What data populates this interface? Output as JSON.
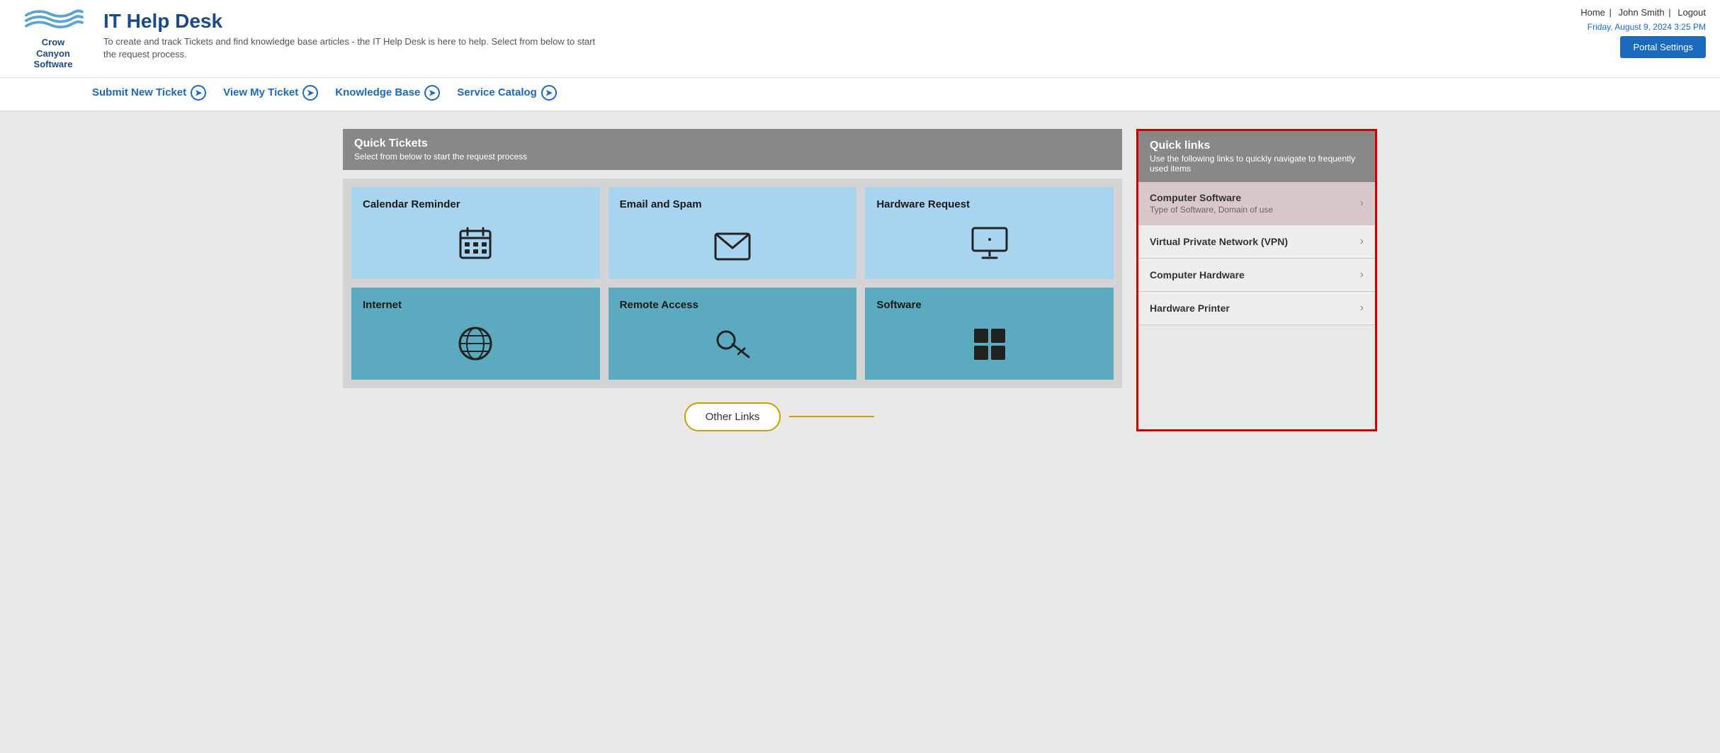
{
  "header": {
    "title": "IT Help Desk",
    "subtitle": "To create and track Tickets and find knowledge base articles - the IT Help Desk is here to help. Select from below to start the request process.",
    "logo_line1": "Crow",
    "logo_line2": "Canyon",
    "logo_line3": "Software",
    "nav_home": "Home",
    "nav_user": "John Smith",
    "nav_logout": "Logout",
    "date": "Friday, August 9, 2024 3:25 PM",
    "portal_settings": "Portal Settings"
  },
  "navbar": {
    "links": [
      {
        "label": "Submit New Ticket",
        "id": "submit-new-ticket"
      },
      {
        "label": "View My Ticket",
        "id": "view-my-ticket"
      },
      {
        "label": "Knowledge Base",
        "id": "knowledge-base"
      },
      {
        "label": "Service Catalog",
        "id": "service-catalog"
      }
    ]
  },
  "quick_tickets": {
    "title": "Quick Tickets",
    "subtitle": "Select from below to start the request process",
    "cards": [
      {
        "title": "Calendar Reminder",
        "icon": "📅",
        "teal": false
      },
      {
        "title": "Email and Spam",
        "icon": "✉️",
        "teal": false
      },
      {
        "title": "Hardware Request",
        "icon": "🖥️",
        "teal": false
      },
      {
        "title": "Internet",
        "icon": "🌐",
        "teal": true
      },
      {
        "title": "Remote Access",
        "icon": "🔑",
        "teal": true
      },
      {
        "title": "Software",
        "icon": "⊞",
        "teal": true
      }
    ]
  },
  "other_links": {
    "label": "Other Links"
  },
  "quick_links": {
    "title": "Quick links",
    "subtitle": "Use the following links to quickly navigate to frequently used items",
    "items": [
      {
        "title": "Computer Software",
        "subtitle": "Type of Software, Domain of use",
        "active": true
      },
      {
        "title": "Virtual Private Network (VPN)",
        "subtitle": "",
        "active": false
      },
      {
        "title": "Computer Hardware",
        "subtitle": "",
        "active": false
      },
      {
        "title": "Hardware Printer",
        "subtitle": "",
        "active": false
      }
    ]
  }
}
